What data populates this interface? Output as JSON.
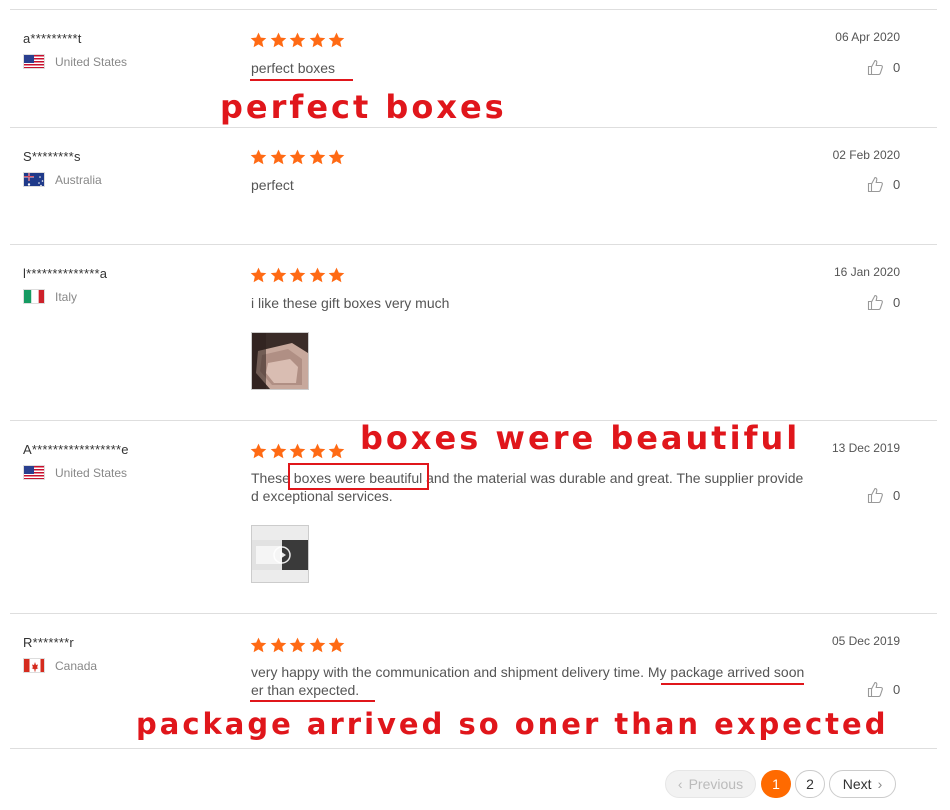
{
  "reviews": [
    {
      "user": "a*********t",
      "country": "United States",
      "flag": "us",
      "stars": 5,
      "text": "perfect boxes",
      "date": "06 Apr 2020",
      "likes": "0"
    },
    {
      "user": "S********s",
      "country": "Australia",
      "flag": "au",
      "stars": 5,
      "text": "perfect",
      "date": "02 Feb 2020",
      "likes": "0"
    },
    {
      "user": "l**************a",
      "country": "Italy",
      "flag": "it",
      "stars": 5,
      "text": "i like these gift boxes very much",
      "date": "16 Jan 2020",
      "likes": "0",
      "has_photo": true
    },
    {
      "user": "A*****************e",
      "country": "United States",
      "flag": "us",
      "stars": 5,
      "text": "These boxes were beautiful and the material was durable and great. The supplier provided exceptional services.",
      "date": "13 Dec 2019",
      "likes": "0",
      "has_photo": true
    },
    {
      "user": "R*******r",
      "country": "Canada",
      "flag": "ca",
      "stars": 5,
      "text": "very happy with the communication and shipment delivery time.  My package arrived sooner than expected.",
      "date": "05 Dec 2019",
      "likes": "0"
    }
  ],
  "annotations": {
    "a1": "perfect boxes",
    "a2": "boxes were beautiful",
    "a3": "package arrived so oner than expected"
  },
  "pagination": {
    "previous": "Previous",
    "pages": [
      "1",
      "2"
    ],
    "current": "1",
    "next": "Next"
  },
  "colors": {
    "star": "#ff6a14",
    "annotation": "#e0161b",
    "current_page": "#ff6a00"
  }
}
